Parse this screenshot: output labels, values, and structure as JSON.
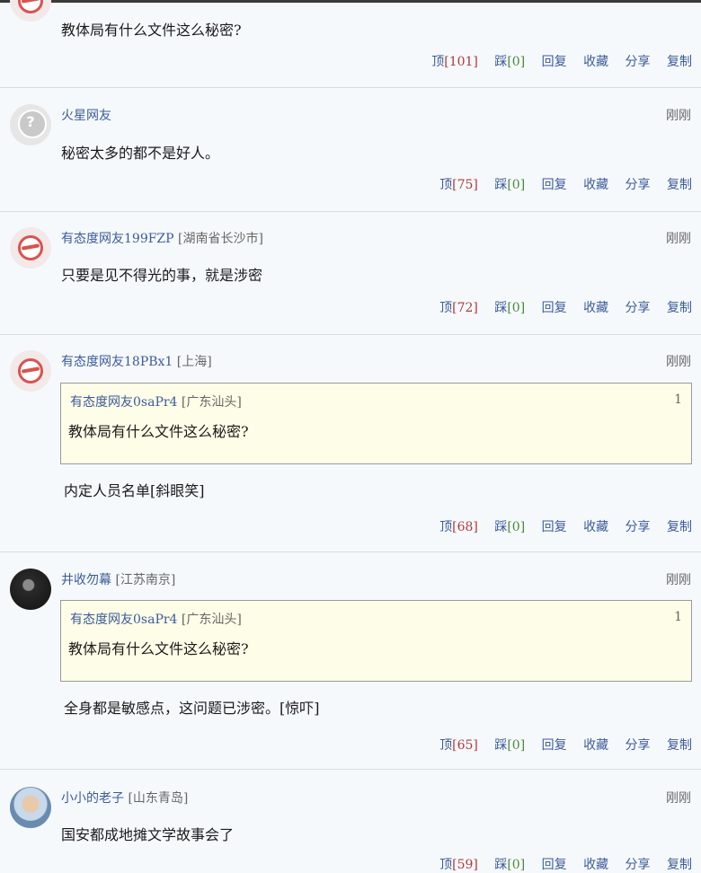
{
  "comments": [
    {
      "content": "教体局有什么文件这么秘密?",
      "actions": {
        "up_label": "顶",
        "up_count": "[101]",
        "down_label": "踩",
        "down_count": "[0]",
        "reply": "回复",
        "fav": "收藏",
        "share": "分享",
        "copy": "复制"
      }
    },
    {
      "name": "火星网友",
      "time": "刚刚",
      "content": "秘密太多的都不是好人。",
      "actions": {
        "up_label": "顶",
        "up_count": "[75]",
        "down_label": "踩",
        "down_count": "[0]",
        "reply": "回复",
        "fav": "收藏",
        "share": "分享",
        "copy": "复制"
      }
    },
    {
      "name": "有态度网友199FZP",
      "location": "[湖南省长沙市]",
      "time": "刚刚",
      "content": "只要是见不得光的事，就是涉密",
      "actions": {
        "up_label": "顶",
        "up_count": "[72]",
        "down_label": "踩",
        "down_count": "[0]",
        "reply": "回复",
        "fav": "收藏",
        "share": "分享",
        "copy": "复制"
      }
    },
    {
      "name": "有态度网友18PBx1",
      "location": "[上海]",
      "time": "刚刚",
      "quote": {
        "name": "有态度网友0saPr4",
        "location": "[广东汕头]",
        "floor": "1",
        "text": "教体局有什么文件这么秘密?"
      },
      "content": "内定人员名单[斜眼笑]",
      "actions": {
        "up_label": "顶",
        "up_count": "[68]",
        "down_label": "踩",
        "down_count": "[0]",
        "reply": "回复",
        "fav": "收藏",
        "share": "分享",
        "copy": "复制"
      }
    },
    {
      "name": "井收勿幕",
      "location": "[江苏南京]",
      "time": "刚刚",
      "quote": {
        "name": "有态度网友0saPr4",
        "location": "[广东汕头]",
        "floor": "1",
        "text": "教体局有什么文件这么秘密?"
      },
      "content": "全身都是敏感点，这问题已涉密。[惊吓]",
      "actions": {
        "up_label": "顶",
        "up_count": "[65]",
        "down_label": "踩",
        "down_count": "[0]",
        "reply": "回复",
        "fav": "收藏",
        "share": "分享",
        "copy": "复制"
      }
    },
    {
      "name": "小小的老子",
      "location": "[山东青岛]",
      "time": "刚刚",
      "content": "国安都成地摊文学故事会了",
      "actions": {
        "up_label": "顶",
        "up_count": "[59]",
        "down_label": "踩",
        "down_count": "[0]",
        "reply": "回复",
        "fav": "收藏",
        "share": "分享",
        "copy": "复制"
      }
    }
  ]
}
